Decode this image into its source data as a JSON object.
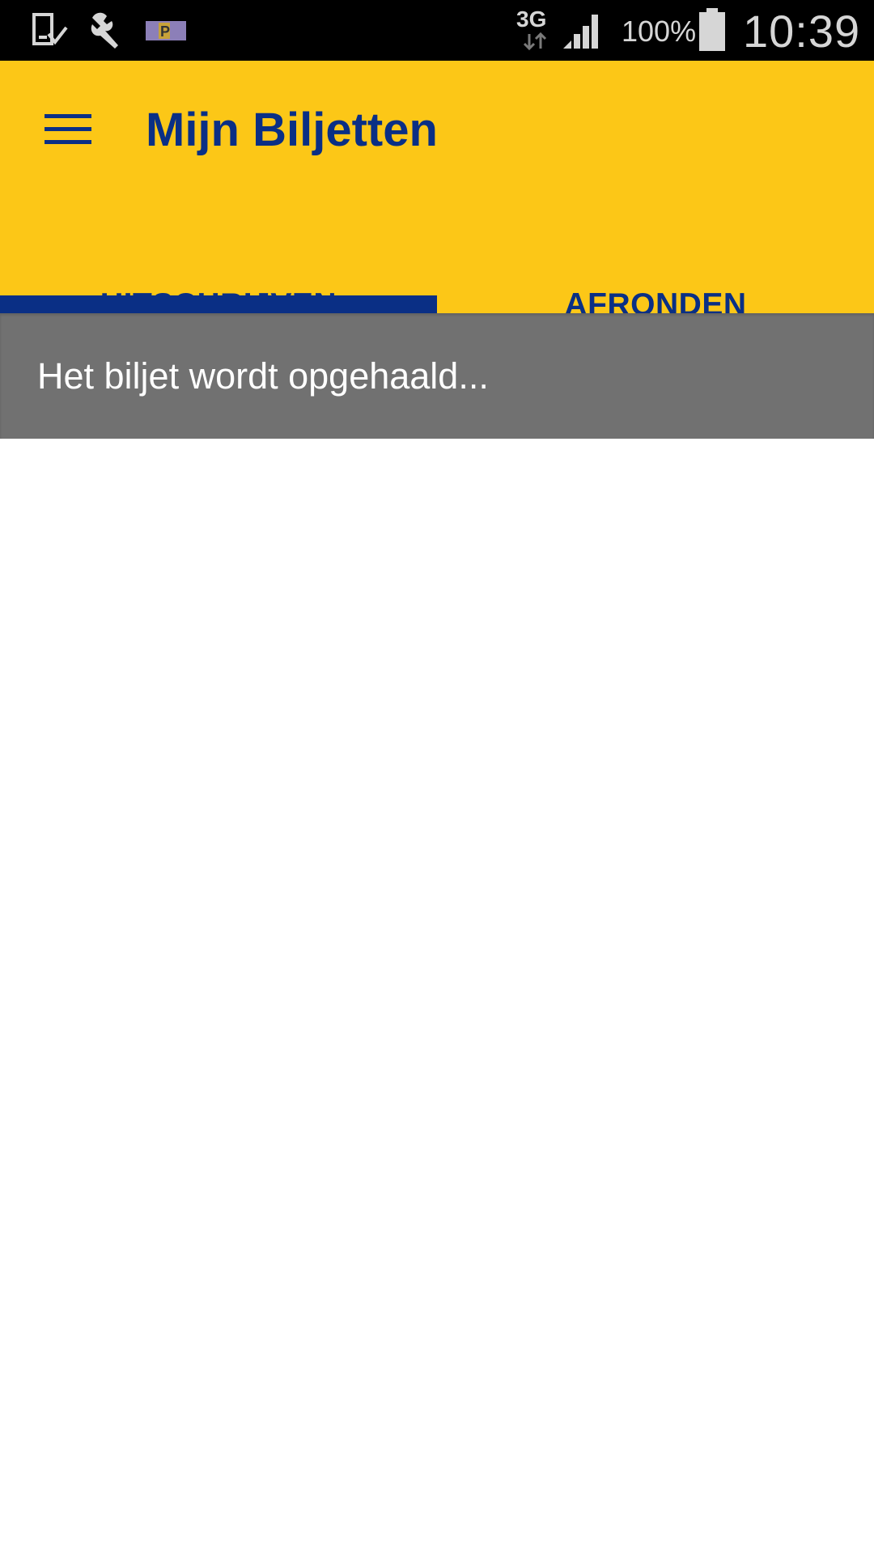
{
  "status_bar": {
    "network_type": "3G",
    "battery_percent": "100%",
    "time": "10:39",
    "icons": [
      "download-complete-icon",
      "wrench-icon",
      "parking-app-icon",
      "data-arrows-icon",
      "signal-icon",
      "battery-icon"
    ]
  },
  "app_bar": {
    "title": "Mijn Biljetten",
    "menu_icon": "hamburger-menu-icon",
    "background_color": "#fcc717",
    "accent_color": "#0a2f85"
  },
  "tabs": [
    {
      "label": "UITSCHRIJVEN",
      "selected": true
    },
    {
      "label": "AFRONDEN",
      "selected": false
    }
  ],
  "banner": {
    "message": "Het biljet wordt opgehaald...",
    "background_color": "#717171"
  }
}
